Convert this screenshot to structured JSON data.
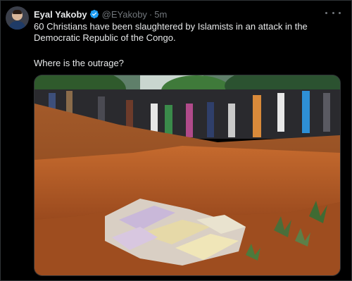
{
  "tweet": {
    "author_name": "Eyal Yakoby",
    "handle": "@EYakoby",
    "separator": "·",
    "time": "5m",
    "text_line1": "60 Christians have been slaughtered by Islamists in an attack in the Democratic Republic of the Congo.",
    "text_line2": "Where is the outrage?"
  },
  "icons": {
    "verified": "verified-badge-icon",
    "more": "more-options-icon"
  },
  "colors": {
    "background": "#000000",
    "text": "#e7e9ea",
    "muted": "#71767b",
    "verified_blue": "#1d9bf0",
    "border": "#2f3336"
  }
}
